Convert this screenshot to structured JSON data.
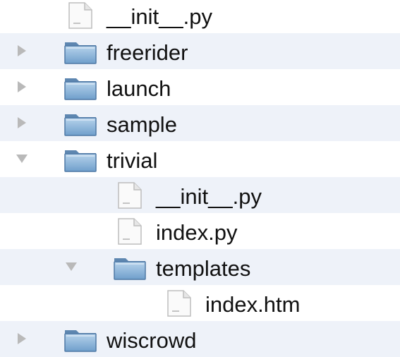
{
  "file_tree": {
    "items": [
      {
        "label": "__init__.py",
        "type": "file",
        "depth": 0,
        "expanded": null
      },
      {
        "label": "freerider",
        "type": "folder",
        "depth": 0,
        "expanded": false
      },
      {
        "label": "launch",
        "type": "folder",
        "depth": 0,
        "expanded": false
      },
      {
        "label": "sample",
        "type": "folder",
        "depth": 0,
        "expanded": false
      },
      {
        "label": "trivial",
        "type": "folder",
        "depth": 0,
        "expanded": true
      },
      {
        "label": "__init__.py",
        "type": "file",
        "depth": 1,
        "expanded": null
      },
      {
        "label": "index.py",
        "type": "file",
        "depth": 1,
        "expanded": null
      },
      {
        "label": "templates",
        "type": "folder",
        "depth": 1,
        "expanded": true
      },
      {
        "label": "index.htm",
        "type": "file",
        "depth": 2,
        "expanded": null
      },
      {
        "label": "wiscrowd",
        "type": "folder",
        "depth": 0,
        "expanded": false
      }
    ]
  },
  "icons": {
    "folder": "folder-icon",
    "file": "file-icon",
    "disclosure_collapsed": "disclosure-triangle-right-icon",
    "disclosure_expanded": "disclosure-triangle-down-icon"
  },
  "colors": {
    "row_alternate": "#eef2f9",
    "folder_blue": "#8ab7dd",
    "triangle_gray": "#b9b9b9"
  }
}
